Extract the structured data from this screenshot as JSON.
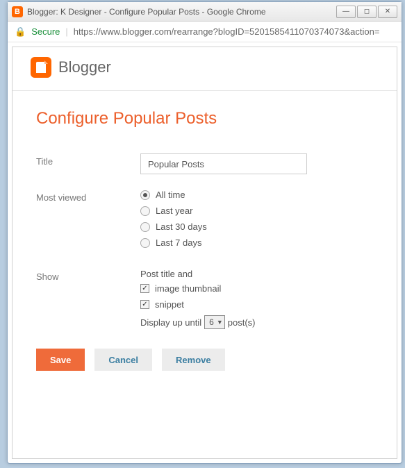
{
  "window": {
    "title": "Blogger: K Designer - Configure Popular Posts - Google Chrome"
  },
  "addressbar": {
    "secure": "Secure",
    "url": "https://www.blogger.com/rearrange?blogID=5201585411070374073&action="
  },
  "brand": {
    "name": "Blogger"
  },
  "heading": "Configure Popular Posts",
  "form": {
    "title_label": "Title",
    "title_value": "Popular Posts",
    "most_viewed_label": "Most viewed",
    "radios": {
      "all_time": "All time",
      "last_year": "Last year",
      "last_30": "Last 30 days",
      "last_7": "Last 7 days"
    },
    "show_label": "Show",
    "show_static": "Post title and",
    "check_thumb": "image thumbnail",
    "check_snippet": "snippet",
    "display_prefix": "Display up until",
    "display_count": "6",
    "display_suffix": "post(s)"
  },
  "buttons": {
    "save": "Save",
    "cancel": "Cancel",
    "remove": "Remove"
  }
}
